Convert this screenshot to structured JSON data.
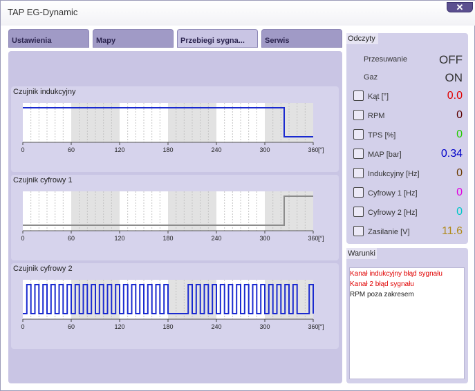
{
  "window": {
    "title": "TAP EG-Dynamic",
    "close_glyph": "✕"
  },
  "tabs": [
    {
      "label": "Ustawienia",
      "active": false
    },
    {
      "label": "Mapy",
      "active": false
    },
    {
      "label": "Przebiegi sygna...",
      "active": true
    },
    {
      "label": "Serwis",
      "active": false
    }
  ],
  "charts": [
    {
      "title": "Czujnik indukcyjny",
      "x_ticks": [
        "0",
        "60",
        "120",
        "180",
        "240",
        "300",
        "360"
      ],
      "unit": "[°]",
      "color": "#1a2ad0",
      "levels": [
        [
          0,
          1
        ],
        [
          324,
          1
        ],
        [
          324,
          0
        ],
        [
          360,
          0
        ]
      ]
    },
    {
      "title": "Czujnik cyfrowy 1",
      "x_ticks": [
        "0",
        "60",
        "120",
        "180",
        "240",
        "300",
        "360"
      ],
      "unit": "[°]",
      "color": "#8c8c8c",
      "levels": [
        [
          0,
          0
        ],
        [
          324,
          0
        ],
        [
          324,
          1
        ],
        [
          360,
          1
        ]
      ]
    },
    {
      "title": "Czujnik cyfrowy 2",
      "x_ticks": [
        "0",
        "60",
        "120",
        "180",
        "240",
        "300",
        "360"
      ],
      "unit": "[°]",
      "color": "#1a2ad0",
      "pulse_width_deg": 5,
      "pulse_starts_deg": [
        5,
        15,
        25,
        35,
        45,
        55,
        65,
        75,
        85,
        95,
        105,
        115,
        125,
        135,
        145,
        155,
        165,
        175,
        205,
        215,
        225,
        235,
        245,
        255,
        265,
        275,
        285,
        295,
        305,
        315,
        325,
        335,
        355
      ]
    }
  ],
  "readings": {
    "title": "Odczyty",
    "status": [
      {
        "label": "Przesuwanie",
        "value": "OFF"
      },
      {
        "label": "Gaz",
        "value": "ON"
      }
    ],
    "items": [
      {
        "label": "Kąt [°]",
        "value": "0.0",
        "color": "#e00000"
      },
      {
        "label": "RPM",
        "value": "0",
        "color": "#5a0000"
      },
      {
        "label": "TPS [%]",
        "value": "0",
        "color": "#22cc00"
      },
      {
        "label": "MAP [bar]",
        "value": "0.34",
        "color": "#0000c8"
      },
      {
        "label": "Indukcyjny [Hz]",
        "value": "0",
        "color": "#6a3a00"
      },
      {
        "label": "Cyfrowy 1 [Hz]",
        "value": "0",
        "color": "#e000e0"
      },
      {
        "label": "Cyfrowy 2 [Hz]",
        "value": "0",
        "color": "#00c8c8"
      },
      {
        "label": "Zasilanie [V]",
        "value": "11.6",
        "color": "#b08a1a"
      }
    ]
  },
  "warnings": {
    "title": "Warunki",
    "lines": [
      {
        "text": "Kanał indukcyjny błąd sygnału",
        "color": "#e00000"
      },
      {
        "text": "Kanał 2 błąd sygnału",
        "color": "#e00000"
      },
      {
        "text": "RPM poza zakresem",
        "color": "#222222"
      }
    ]
  }
}
